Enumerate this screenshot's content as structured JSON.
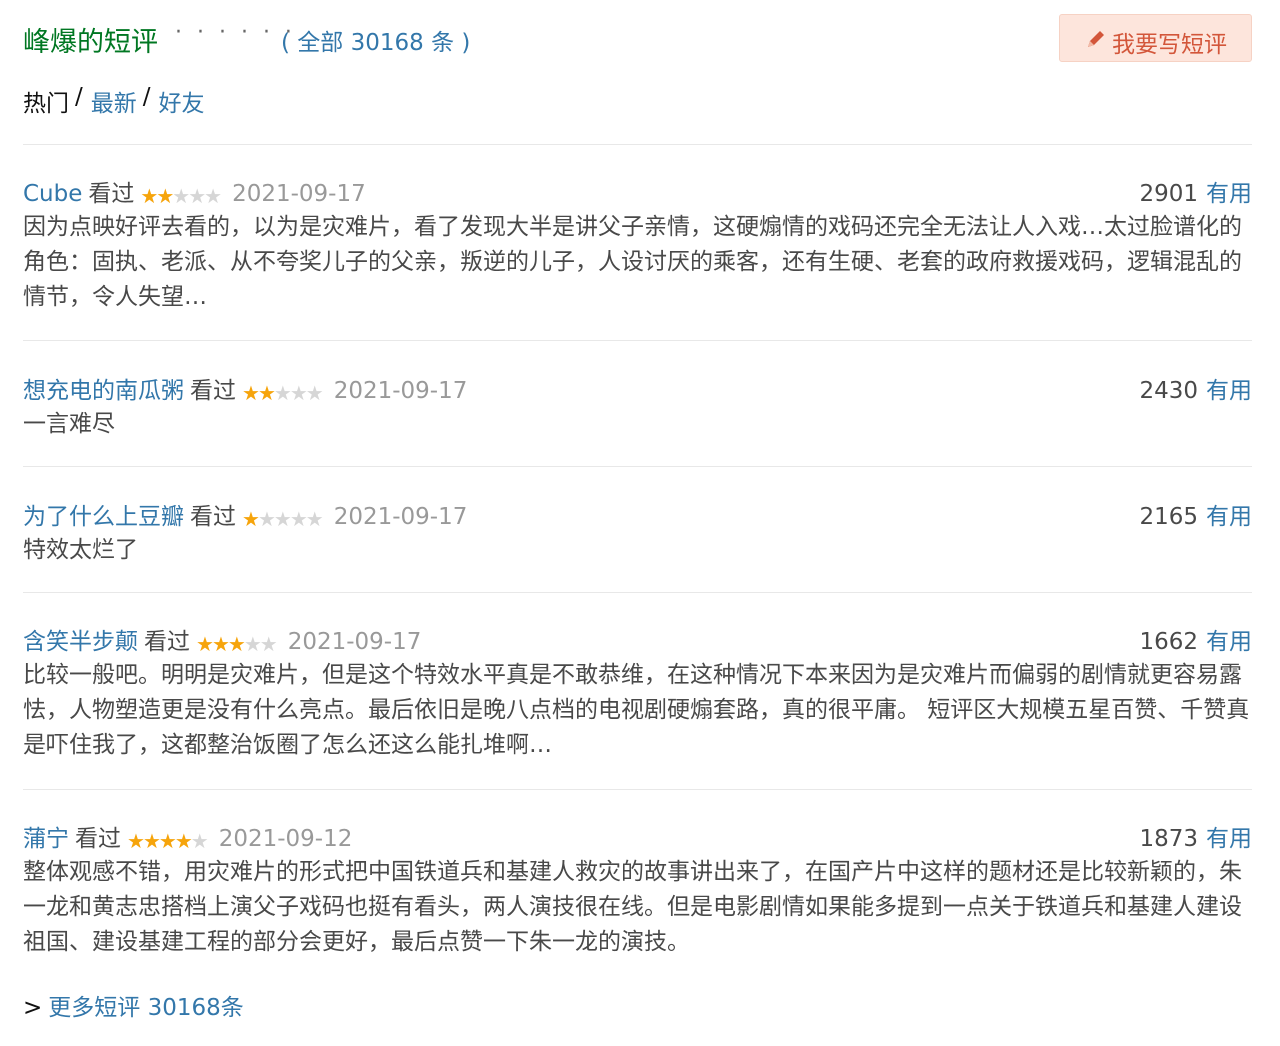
{
  "header": {
    "title": "峰爆的短评",
    "dots": "· · · · · ·",
    "total_label": "( 全部 30168 条 )",
    "write_button_label": "我要写短评",
    "write_icon": "pencil-icon"
  },
  "tabs": [
    {
      "label": "热门",
      "active": true
    },
    {
      "label": "最新",
      "active": false
    },
    {
      "label": "好友",
      "active": false
    }
  ],
  "tab_separator": "/",
  "comments": [
    {
      "user": "Cube",
      "status": "看过",
      "rating": 2,
      "rating_max": 5,
      "date": "2021-09-17",
      "votes": "2901",
      "useful_label": "有用",
      "content": "因为点映好评去看的，以为是灾难片，看了发现大半是讲父子亲情，这硬煽情的戏码还完全无法让人入戏…太过脸谱化的角色：固执、老派、从不夸奖儿子的父亲，叛逆的儿子，人设讨厌的乘客，还有生硬、老套的政府救援戏码，逻辑混乱的情节，令人失望…"
    },
    {
      "user": "想充电的南瓜粥",
      "status": "看过",
      "rating": 2,
      "rating_max": 5,
      "date": "2021-09-17",
      "votes": "2430",
      "useful_label": "有用",
      "content": "一言难尽"
    },
    {
      "user": "为了什么上豆瓣",
      "status": "看过",
      "rating": 1,
      "rating_max": 5,
      "date": "2021-09-17",
      "votes": "2165",
      "useful_label": "有用",
      "content": "特效太烂了"
    },
    {
      "user": "含笑半步颠",
      "status": "看过",
      "rating": 3,
      "rating_max": 5,
      "date": "2021-09-17",
      "votes": "1662",
      "useful_label": "有用",
      "content": "比较一般吧。明明是灾难片，但是这个特效水平真是不敢恭维，在这种情况下本来因为是灾难片而偏弱的剧情就更容易露怯，人物塑造更是没有什么亮点。最后依旧是晚八点档的电视剧硬煽套路，真的很平庸。 短评区大规模五星百赞、千赞真是吓住我了，这都整治饭圈了怎么还这么能扎堆啊…"
    },
    {
      "user": "蒲宁",
      "status": "看过",
      "rating": 4,
      "rating_max": 5,
      "date": "2021-09-12",
      "votes": "1873",
      "useful_label": "有用",
      "content": "整体观感不错，用灾难片的形式把中国铁道兵和基建人救灾的故事讲出来了，在国产片中这样的题材还是比较新颖的，朱一龙和黄志忠搭档上演父子戏码也挺有看头，两人演技很在线。但是电影剧情如果能多提到一点关于铁道兵和基建人建设祖国、建设基建工程的部分会更好，最后点赞一下朱一龙的演技。"
    }
  ],
  "more": {
    "arrow": ">",
    "label": "更多短评 30168条"
  },
  "colors": {
    "title_green": "#007722",
    "link_blue": "#3377aa",
    "star_gold": "#f6a40b",
    "button_bg": "#fde5dc",
    "button_text": "#d3563a"
  }
}
